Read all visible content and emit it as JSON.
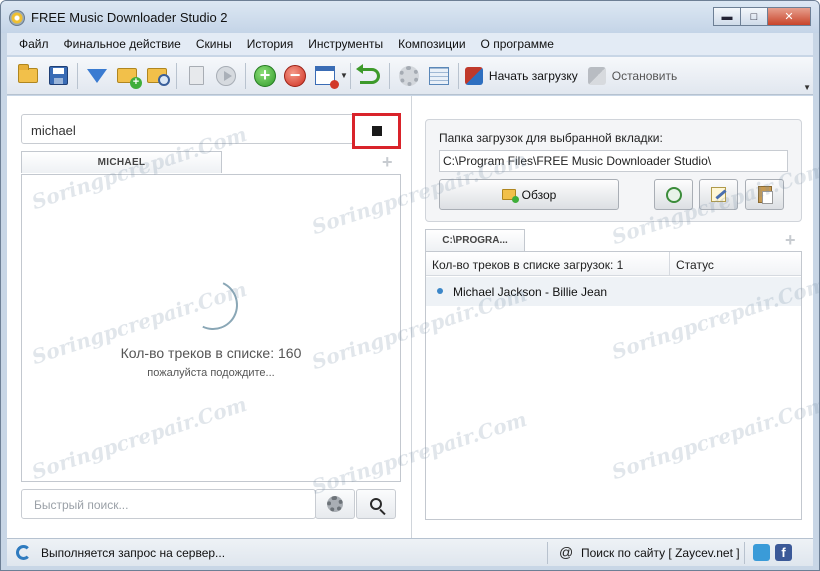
{
  "window": {
    "title": "FREE Music Downloader Studio 2",
    "controls": {
      "minimize": "▬",
      "maximize": "□",
      "close": "✕"
    }
  },
  "menu": [
    "Файл",
    "Финальное действие",
    "Скины",
    "История",
    "Инструменты",
    "Композиции",
    "О программе"
  ],
  "toolbar": {
    "icons": [
      "folder-open-icon",
      "save-icon",
      "filter-add-icon",
      "add-folder-icon",
      "search-folder-icon",
      "doc-info-icon",
      "play-icon",
      "add-icon",
      "remove-icon",
      "window-remove-icon",
      "undo-icon",
      "gear-icon",
      "table-icon"
    ],
    "start_label": "Начать загрузку",
    "stop_label": "Остановить"
  },
  "search": {
    "value": "michael",
    "stop_glyph": "■"
  },
  "left_tab": {
    "label": "MICHAEL"
  },
  "left_panel": {
    "count_text": "Кол-во треков в списке: 160",
    "wait_text": "пожалуйста подождите..."
  },
  "quick_search": {
    "placeholder": "Быстрый поиск..."
  },
  "download_folder": {
    "label": "Папка загрузок для выбранной вкладки:",
    "path": "C:\\Program Files\\FREE Music Downloader Studio\\",
    "browse_label": "Обзор"
  },
  "right_tab": {
    "label": "C:\\PROGRA..."
  },
  "download_table": {
    "header_count": "Кол-во треков в списке загрузок: 1",
    "header_status": "Статус",
    "rows": [
      {
        "title": "Michael Jackson - Billie Jean"
      }
    ]
  },
  "statusbar": {
    "status_text": "Выполняется запрос на сервер...",
    "site_text": "Поиск по сайту [ Zaycev.net ]",
    "fb_glyph": "f"
  },
  "add_tab_glyph": "+",
  "watermark": "Soringpcrepair.Com",
  "colors": {
    "highlight_box": "#d9232a",
    "title_bar": "#c4d4e7",
    "row_bullet": "#3b86c8"
  }
}
